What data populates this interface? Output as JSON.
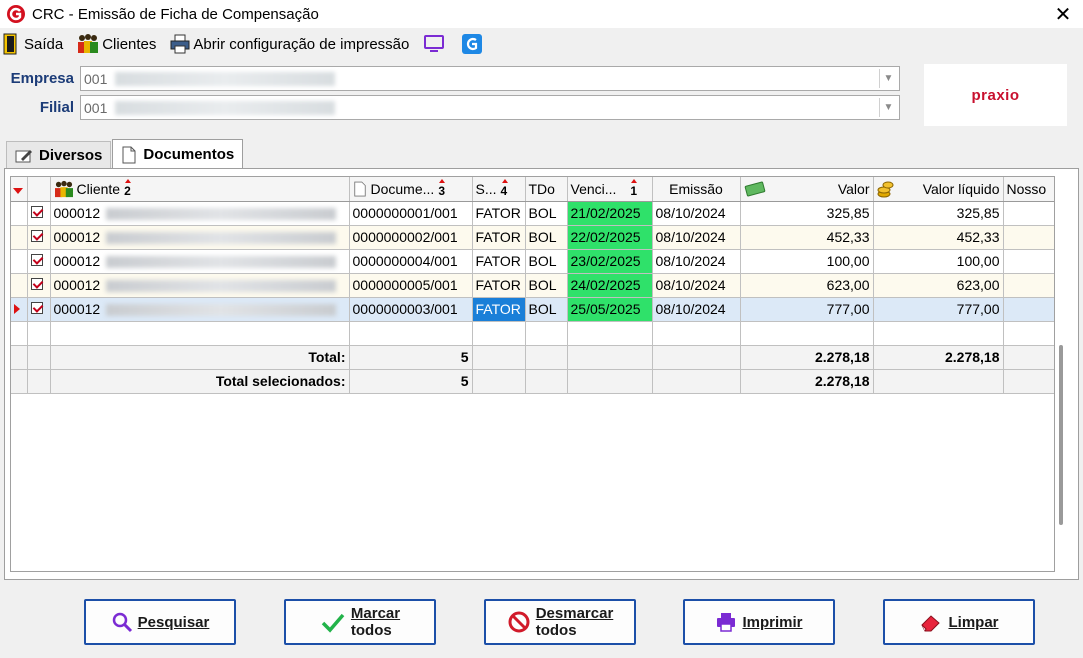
{
  "window": {
    "title": "CRC - Emissão de Ficha de Compensação"
  },
  "toolbar": {
    "exit_label": "Saída",
    "clients_label": "Clientes",
    "print_config_label": "Abrir configuração de impressão"
  },
  "form": {
    "empresa": {
      "label": "Empresa",
      "code": "001"
    },
    "filial": {
      "label": "Filial",
      "code": "001"
    }
  },
  "brand": {
    "logo_text": "praxio"
  },
  "tabs": [
    {
      "label": "Diversos",
      "active": false
    },
    {
      "label": "Documentos",
      "active": true
    }
  ],
  "grid": {
    "columns": [
      {
        "label": "Cliente",
        "sort": "2"
      },
      {
        "label": "Docume...",
        "sort": "3"
      },
      {
        "label": "S...",
        "sort": "4"
      },
      {
        "label": "TDo",
        "sort": ""
      },
      {
        "label": "Venci...",
        "sort": "1"
      },
      {
        "label": "Emissão",
        "sort": ""
      },
      {
        "label": "Valor",
        "sort": ""
      },
      {
        "label": "Valor líquido",
        "sort": ""
      },
      {
        "label": "Nosso",
        "sort": ""
      }
    ],
    "rows": [
      {
        "client": "000012",
        "document": "0000000001/001",
        "status": "FATOR",
        "tdo": "BOL",
        "due": "21/02/2025",
        "issue": "08/10/2024",
        "value": "325,85",
        "net": "325,85"
      },
      {
        "client": "000012",
        "document": "0000000002/001",
        "status": "FATOR",
        "tdo": "BOL",
        "due": "22/02/2025",
        "issue": "08/10/2024",
        "value": "452,33",
        "net": "452,33"
      },
      {
        "client": "000012",
        "document": "0000000004/001",
        "status": "FATOR",
        "tdo": "BOL",
        "due": "23/02/2025",
        "issue": "08/10/2024",
        "value": "100,00",
        "net": "100,00"
      },
      {
        "client": "000012",
        "document": "0000000005/001",
        "status": "FATOR",
        "tdo": "BOL",
        "due": "24/02/2025",
        "issue": "08/10/2024",
        "value": "623,00",
        "net": "623,00"
      },
      {
        "client": "000012",
        "document": "0000000003/001",
        "status": "FATOR",
        "tdo": "BOL",
        "due": "25/05/2025",
        "issue": "08/10/2024",
        "value": "777,00",
        "net": "777,00"
      }
    ],
    "totals": {
      "total_label": "Total:",
      "total_count": "5",
      "total_value": "2.278,18",
      "total_net": "2.278,18",
      "selected_label": "Total selecionados:",
      "selected_count": "5",
      "selected_value": "2.278,18"
    }
  },
  "buttons": {
    "search": "Pesquisar",
    "mark_all_1": "Marcar",
    "mark_all_2": "todos",
    "unmark_all_1": "Desmarcar",
    "unmark_all_2": "todos",
    "print": "Imprimir",
    "clear": "Limpar"
  },
  "colors": {
    "due_highlight": "#2fe16a",
    "selection": "#1a7fd8",
    "label_blue": "#1c3c78",
    "button_border": "#1c4fa8"
  }
}
